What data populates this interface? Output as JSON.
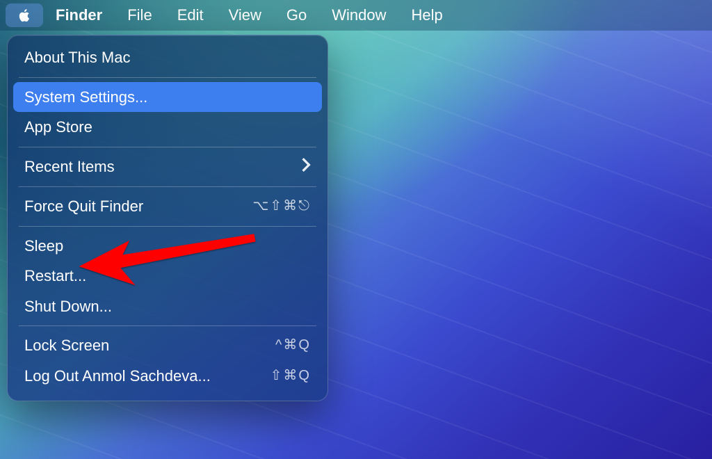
{
  "menubar": {
    "apple_icon": "apple-logo",
    "app_name": "Finder",
    "items": [
      "File",
      "Edit",
      "View",
      "Go",
      "Window",
      "Help"
    ]
  },
  "apple_menu": {
    "about_label": "About This Mac",
    "system_settings_label": "System Settings...",
    "app_store_label": "App Store",
    "recent_items_label": "Recent Items",
    "force_quit_label": "Force Quit Finder",
    "force_quit_shortcut": "⌥⇧⌘⎋",
    "sleep_label": "Sleep",
    "restart_label": "Restart...",
    "shut_down_label": "Shut Down...",
    "lock_screen_label": "Lock Screen",
    "lock_screen_shortcut": "^⌘Q",
    "log_out_label": "Log Out Anmol Sachdeva...",
    "log_out_shortcut": "⇧⌘Q"
  },
  "annotation": {
    "arrow_color": "#ff0000",
    "points_to": "restart"
  }
}
